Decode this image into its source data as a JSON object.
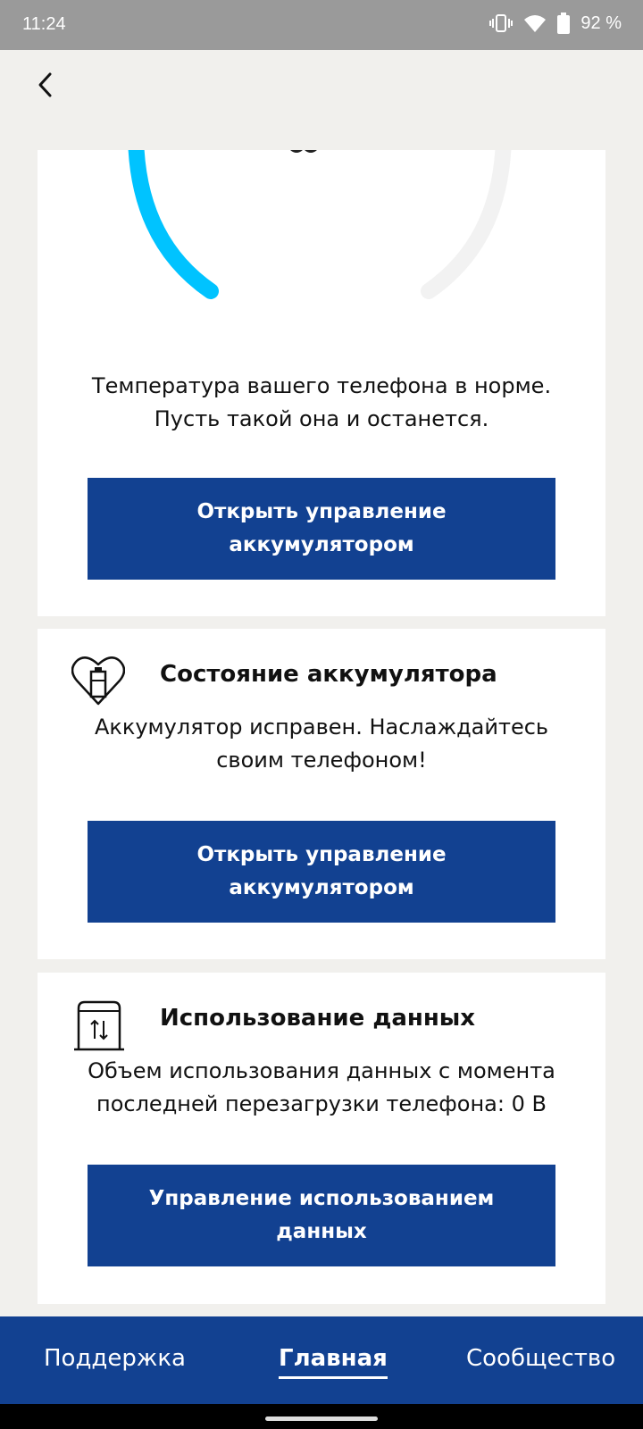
{
  "status_bar": {
    "time": "11:24",
    "battery_percent": "92 %",
    "icons": [
      "vibrate-icon",
      "wifi-icon",
      "battery-icon"
    ]
  },
  "header": {
    "back_icon": "chevron-left-icon"
  },
  "temperature_card": {
    "gauge_accent_color": "#00c3ff",
    "message_line1": "Температура вашего телефона в норме.",
    "message_line2": "Пусть такой она и останется.",
    "button_line1": "Открыть управление",
    "button_line2": "аккумулятором"
  },
  "battery_card": {
    "icon": "heart-battery-icon",
    "title": "Состояние аккумулятора",
    "message_line1": "Аккумулятор исправен. Наслаждайтесь",
    "message_line2": "своим телефоном!",
    "button_line1": "Открыть управление",
    "button_line2": "аккумулятором"
  },
  "data_card": {
    "icon": "data-transfer-icon",
    "title": "Использование данных",
    "message_line1": "Объем использования данных с момента",
    "message_line2": "последней перезагрузки телефона: 0 B",
    "button_line1": "Управление использованием",
    "button_line2": "данных"
  },
  "bottom_nav": {
    "items": [
      {
        "label": "Поддержка",
        "active": false
      },
      {
        "label": "Главная",
        "active": true
      },
      {
        "label": "Сообщество",
        "active": false
      }
    ]
  },
  "colors": {
    "brand_blue": "#124191",
    "background": "#f1f0ed"
  }
}
